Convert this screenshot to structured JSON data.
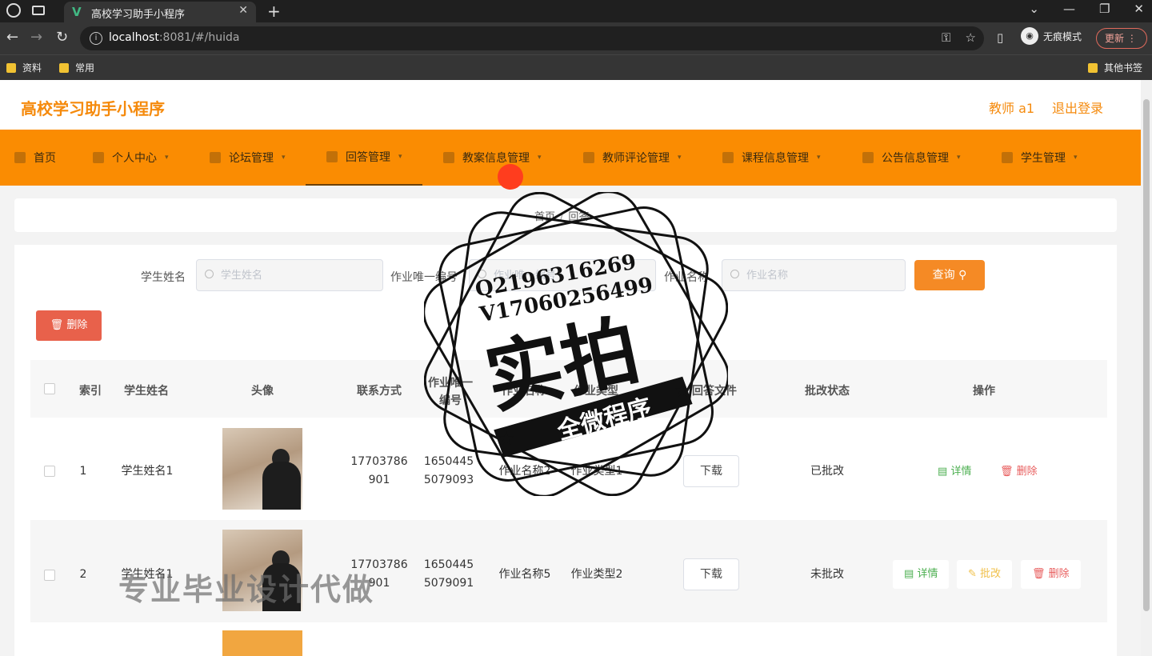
{
  "browser": {
    "tab_title": "高校学习助手小程序",
    "favicon": "V",
    "url_host": "localhost",
    "url_rest": ":8081/#/huida",
    "incognito_label": "无痕模式",
    "update_label": "更新",
    "bookmarks": [
      "资料",
      "常用"
    ],
    "other_bookmarks": "其他书签"
  },
  "header": {
    "app_title": "高校学习助手小程序",
    "user": "教师 a1",
    "logout": "退出登录"
  },
  "nav": [
    {
      "label": "首页"
    },
    {
      "label": "个人中心"
    },
    {
      "label": "论坛管理"
    },
    {
      "label": "回答管理"
    },
    {
      "label": "教案信息管理"
    },
    {
      "label": "教师评论管理"
    },
    {
      "label": "课程信息管理"
    },
    {
      "label": "公告信息管理"
    },
    {
      "label": "学生管理"
    }
  ],
  "breadcrumb": {
    "home": "首页",
    "current": "回答"
  },
  "search": {
    "student_name_label": "学生姓名",
    "student_name_placeholder": "学生姓名",
    "homework_id_label": "作业唯一编号",
    "homework_id_placeholder": "作业唯一编号",
    "homework_name_label": "作业名称",
    "homework_name_placeholder": "作业名称",
    "query_label": "查询"
  },
  "batch_delete_label": "删除",
  "table": {
    "columns": [
      "索引",
      "学生姓名",
      "头像",
      "联系方式",
      "作业唯一编号",
      "作业名称",
      "作业类型",
      "回答文件",
      "批改状态",
      "操作"
    ],
    "rows": [
      {
        "index": "1",
        "student_name": "学生姓名1",
        "phone": "17703786901",
        "homework_id": "16504455079093",
        "homework_name": "作业名称2",
        "homework_type": "作业类型1",
        "download": "下载",
        "status": "已批改",
        "ops": [
          "详情",
          "删除"
        ]
      },
      {
        "index": "2",
        "student_name": "学生姓名1",
        "phone": "17703786901",
        "homework_id": "16504455079091",
        "homework_name": "作业名称5",
        "homework_type": "作业类型2",
        "download": "下载",
        "status": "未批改",
        "ops": [
          "详情",
          "批改",
          "删除"
        ]
      }
    ]
  },
  "watermark": {
    "line1": "Q2196316269",
    "line2": "V17060256499",
    "big": "实拍",
    "ribbon": "全微程序",
    "bottom": "专业毕业设计代做"
  },
  "colors": {
    "accent": "#fa8c02",
    "brand_text": "#f58a0c",
    "danger": "#e8614b"
  }
}
